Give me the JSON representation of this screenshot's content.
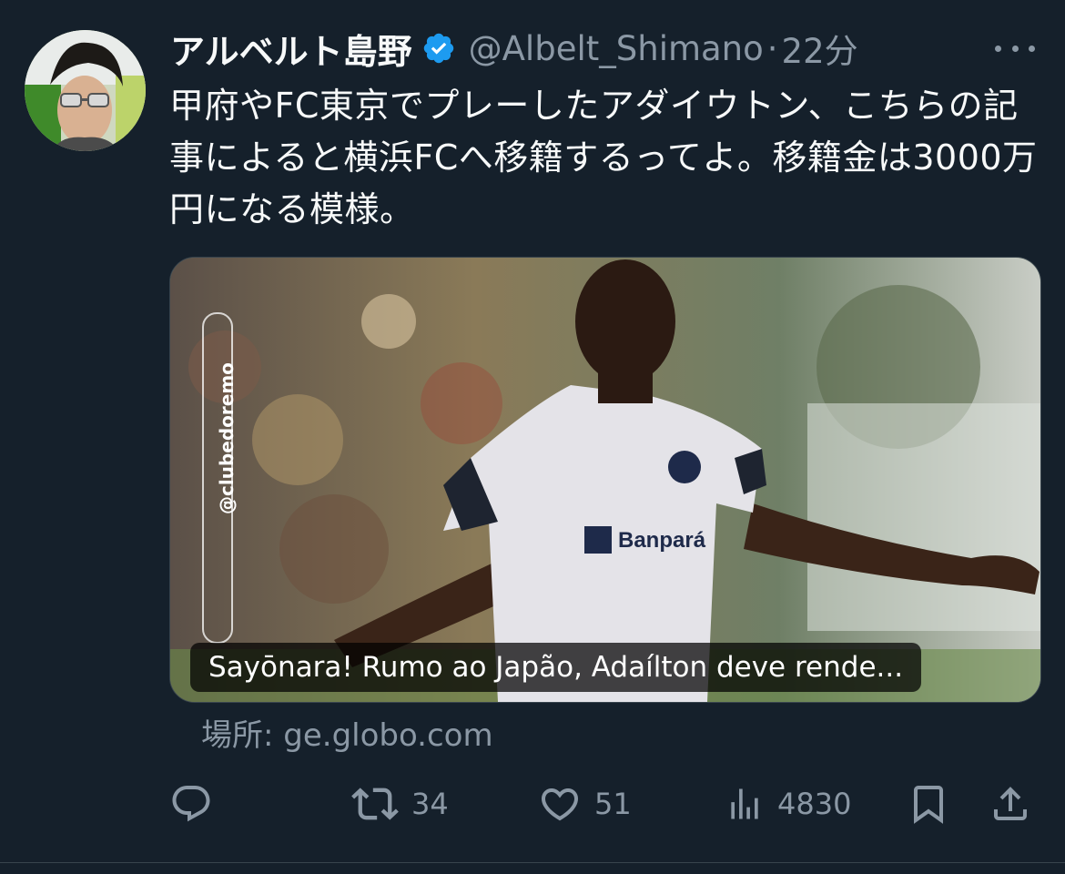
{
  "author": {
    "display_name": "アルベルト島野",
    "handle": "@Albelt_Shimano",
    "separator": "·",
    "time": "22分"
  },
  "tweet": {
    "text": "甲府やFC東京でプレーしたアダイウトン、こちらの記事によると横浜FCへ移籍するってよ。移籍金は3000万円になる模様。"
  },
  "link_card": {
    "caption": "Sayōnara! Rumo ao Japão, Adaílton deve rende...",
    "overlay_handle": "@clubedoremo",
    "source": "場所: ge.globo.com",
    "jersey_sponsor": "Banpará"
  },
  "actions": {
    "reply_count": "",
    "retweet_count": "34",
    "like_count": "51",
    "views_count": "4830"
  },
  "colors": {
    "background": "#15202b",
    "verified": "#1d9bf0",
    "muted": "#8b98a5",
    "text": "#f7f9f9"
  },
  "icons": [
    "more-icon",
    "verified-badge-icon",
    "reply-icon",
    "retweet-icon",
    "like-icon",
    "views-icon",
    "bookmark-icon",
    "share-icon"
  ]
}
